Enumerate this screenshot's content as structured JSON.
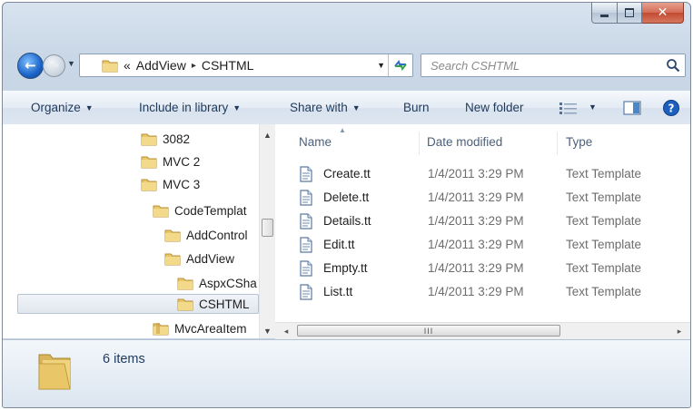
{
  "window": {
    "caption_minimize": "–",
    "caption_maximize": "□",
    "caption_close": "✕"
  },
  "navigation": {
    "back_glyph": "←",
    "forward_glyph": "→",
    "dropdown_glyph": "▼"
  },
  "address": {
    "prefix": "«",
    "path": [
      "AddView",
      "CSHTML"
    ],
    "separator": "▸",
    "dropdown_glyph": "▼"
  },
  "search": {
    "placeholder": "Search CSHTML"
  },
  "command_bar": {
    "organize": "Organize",
    "include_in_library": "Include in library",
    "share_with": "Share with",
    "burn": "Burn",
    "new_folder": "New folder",
    "caret": "▼",
    "help_glyph": "?"
  },
  "navigation_pane": {
    "items": [
      {
        "label": "3082"
      },
      {
        "label": "MVC 2"
      },
      {
        "label": "MVC 3"
      },
      {
        "label": "CodeTemplat"
      },
      {
        "label": "AddControl"
      },
      {
        "label": "AddView"
      },
      {
        "label": "AspxCSha"
      },
      {
        "label": "CSHTML"
      },
      {
        "label": "MvcAreaItem"
      }
    ],
    "scroll_up_glyph": "▲",
    "scroll_down_glyph": "▼"
  },
  "file_list": {
    "columns": {
      "name": "Name",
      "date_modified": "Date modified",
      "type": "Type"
    },
    "sort_glyph": "▲",
    "files": [
      {
        "name": "Create.tt",
        "date": "1/4/2011 3:29 PM",
        "type": "Text Template"
      },
      {
        "name": "Delete.tt",
        "date": "1/4/2011 3:29 PM",
        "type": "Text Template"
      },
      {
        "name": "Details.tt",
        "date": "1/4/2011 3:29 PM",
        "type": "Text Template"
      },
      {
        "name": "Edit.tt",
        "date": "1/4/2011 3:29 PM",
        "type": "Text Template"
      },
      {
        "name": "Empty.tt",
        "date": "1/4/2011 3:29 PM",
        "type": "Text Template"
      },
      {
        "name": "List.tt",
        "date": "1/4/2011 3:29 PM",
        "type": "Text Template"
      }
    ],
    "scroll_left_glyph": "◂",
    "scroll_right_glyph": "▸",
    "thumb_grip": "III"
  },
  "details": {
    "item_count": "6 items"
  },
  "colors": {
    "folder_yellow": "#e8c66a",
    "accent_blue": "#1e395b",
    "back_button_blue": "#1b64c8"
  },
  "icons": {
    "folder": "folder-icon",
    "text_document": "text-document-icon",
    "refresh": "refresh-icon",
    "search": "search-icon",
    "view_options": "view-options-icon",
    "preview_pane": "preview-pane-icon",
    "help": "help-icon"
  }
}
